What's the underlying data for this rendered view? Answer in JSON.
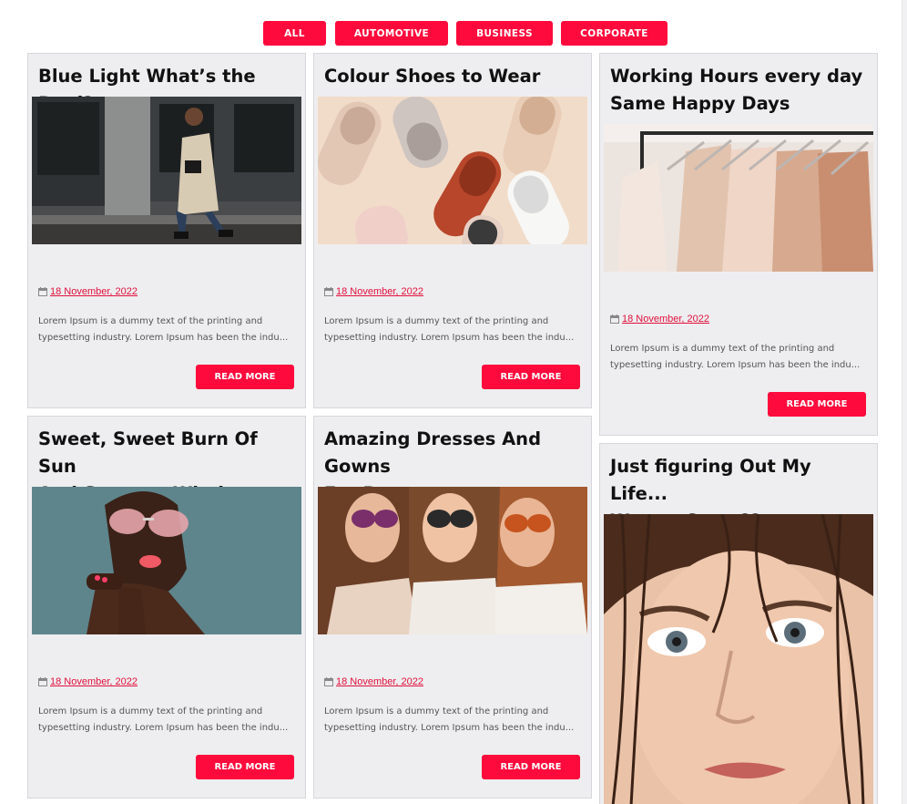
{
  "filters": [
    "ALL",
    "AUTOMOTIVE",
    "BUSINESS",
    "CORPORATE"
  ],
  "colors": {
    "accent": "#ff0a3c",
    "card_bg": "#eeeef0",
    "title": "#111111",
    "date": "#e0103c"
  },
  "posts": [
    {
      "title_lines": [
        "Blue Light What’s the Deal?"
      ],
      "image": "woman-walking-city-street-photo",
      "date": "18 November, 2022",
      "excerpt_lines": [
        "Lorem Ipsum is a dummy text of the printing and",
        "typesetting industry. Lorem Ipsum has been the indu..."
      ],
      "button": "READ MORE"
    },
    {
      "title_lines": [
        "Colour Shoes to Wear"
      ],
      "image": "colorful-mule-shoes-photo",
      "date": "18 November, 2022",
      "excerpt_lines": [
        "Lorem Ipsum is a dummy text of the printing and",
        "typesetting industry. Lorem Ipsum has been the indu..."
      ],
      "button": "READ MORE"
    },
    {
      "title_lines": [
        "Working Hours every day",
        "Same Happy Days"
      ],
      "image": "clothes-rack-hangers-photo",
      "date": "18 November, 2022",
      "excerpt_lines": [
        "Lorem Ipsum is a dummy text of the printing and",
        "typesetting industry. Lorem Ipsum has been the indu..."
      ],
      "button": "READ MORE"
    },
    {
      "title_lines": [
        "Sweet, Sweet Burn Of Sun",
        "And Summer Wind."
      ],
      "image": "woman-pink-sunglasses-photo",
      "date": "18 November, 2022",
      "excerpt_lines": [
        "Lorem Ipsum is a dummy text of the printing and",
        "typesetting industry. Lorem Ipsum has been the indu..."
      ],
      "button": "READ MORE"
    },
    {
      "title_lines": [
        "Amazing Dresses And Gowns",
        "For Prom."
      ],
      "image": "three-women-sunglasses-photo",
      "date": "18 November, 2022",
      "excerpt_lines": [
        "Lorem Ipsum is a dummy text of the printing and",
        "typesetting industry. Lorem Ipsum has been the indu..."
      ],
      "button": "READ MORE"
    },
    {
      "title_lines": [
        "Just figuring Out My Life...",
        "Wanna Come??"
      ],
      "image": "woman-wet-hair-portrait-photo"
    }
  ]
}
